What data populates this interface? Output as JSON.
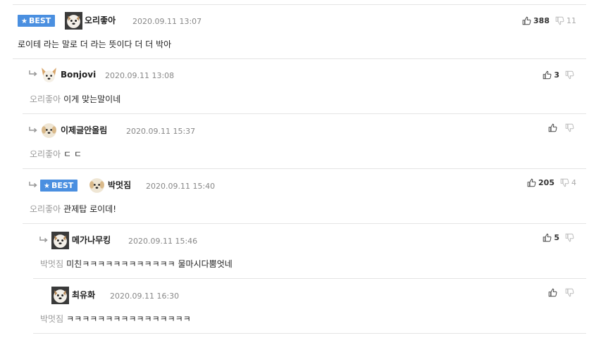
{
  "badge_best": "BEST",
  "comments": [
    {
      "nick": "오리좋아",
      "date": "2020.09.11 13:07",
      "upvotes": "388",
      "downvotes": "11",
      "mention": "",
      "text": "로이테 라는 말로 더 라는 뜻이다 더 더 박아"
    },
    {
      "nick": "Bonjovi",
      "date": "2020.09.11 13:08",
      "upvotes": "3",
      "downvotes": "",
      "mention": "오리좋아",
      "text": "이게 맞는말이네"
    },
    {
      "nick": "이제글안올림",
      "date": "2020.09.11 15:37",
      "upvotes": "",
      "downvotes": "",
      "mention": "오리좋아",
      "text": "ㄷ ㄷ"
    },
    {
      "nick": "박멋짐",
      "date": "2020.09.11 15:40",
      "upvotes": "205",
      "downvotes": "4",
      "mention": "오리좋아",
      "text": "관제탑 로이데!"
    },
    {
      "nick": "메가나무킹",
      "date": "2020.09.11 15:46",
      "upvotes": "5",
      "downvotes": "",
      "mention": "박멋짐",
      "text": "미친ㅋㅋㅋㅋㅋㅋㅋㅋㅋㅋㅋㅋ 물마시다뿜엇네"
    },
    {
      "nick": "최유화",
      "date": "2020.09.11 16:30",
      "upvotes": "",
      "downvotes": "",
      "mention": "박멋짐",
      "text": "ㅋㅋㅋㅋㅋㅋㅋㅋㅋㅋㅋㅋㅋㅋㅋㅋ"
    }
  ],
  "colors": {
    "best_badge": "#4a8fe0",
    "mention": "#999999",
    "date": "#888888"
  },
  "icons": {
    "best": "star-icon",
    "reply": "reply-arrow-icon",
    "up": "thumbs-up-icon",
    "down": "thumbs-down-icon",
    "avatar": "dog-avatar-icon"
  }
}
